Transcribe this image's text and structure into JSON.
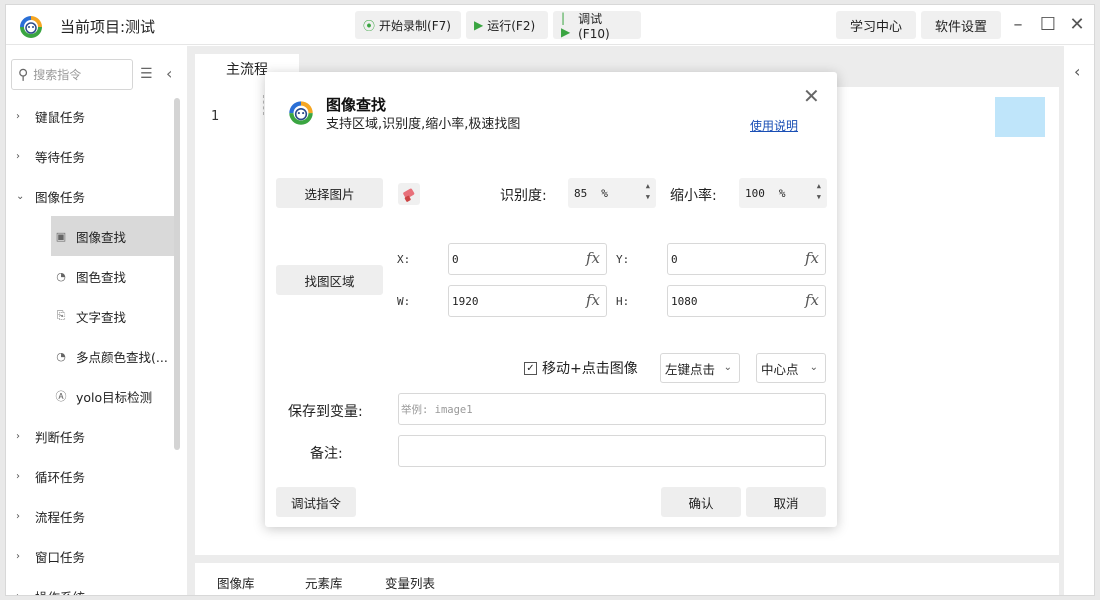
{
  "app": {
    "title": "当前项目:测试",
    "toolbar": {
      "record_label": "开始录制(F7)",
      "run_label": "运行(F2)",
      "debug_label": "调试(F10)"
    },
    "learn_label": "学习中心",
    "settings_label": "软件设置"
  },
  "sidebar": {
    "search_placeholder": "搜索指令",
    "categories": [
      {
        "label": "键鼠任务"
      },
      {
        "label": "等待任务"
      },
      {
        "label": "图像任务"
      },
      {
        "label": "判断任务"
      },
      {
        "label": "循环任务"
      },
      {
        "label": "流程任务"
      },
      {
        "label": "窗口任务"
      },
      {
        "label": "操作系统"
      }
    ],
    "image_items": [
      {
        "label": "图像查找"
      },
      {
        "label": "图色查找"
      },
      {
        "label": "文字查找"
      },
      {
        "label": "多点颜色查找(..."
      },
      {
        "label": "yolo目标检测"
      }
    ]
  },
  "main": {
    "tab_label": "主流程",
    "line_number": "1",
    "bottom_tabs": [
      "图像库",
      "元素库",
      "变量列表"
    ]
  },
  "dialog": {
    "title": "图像查找",
    "subtitle": "支持区域,识别度,缩小率,极速找图",
    "help_link": "使用说明",
    "select_image_label": "选择图片",
    "recognition_label": "识别度:",
    "recognition_value": "85",
    "recognition_unit": "%",
    "shrink_label": "缩小率:",
    "shrink_value": "100",
    "shrink_unit": "%",
    "region_label": "找图区域",
    "x_label": "X:",
    "x_value": "0",
    "y_label": "Y:",
    "y_value": "0",
    "w_label": "W:",
    "w_value": "1920",
    "h_label": "H:",
    "h_value": "1080",
    "fx_label": "fx",
    "move_click_label": "移动+点击图像",
    "move_click_checked": true,
    "click_type": "左键点击",
    "click_point": "中心点",
    "save_var_label": "保存到变量:",
    "save_var_placeholder": "举例: image1",
    "note_label": "备注:",
    "debug_button": "调试指令",
    "confirm_button": "确认",
    "cancel_button": "取消"
  },
  "colors": {
    "accent_green": "#3aa541",
    "highlight_blue": "#bfe5fa",
    "link_blue": "#1a4fb5"
  }
}
